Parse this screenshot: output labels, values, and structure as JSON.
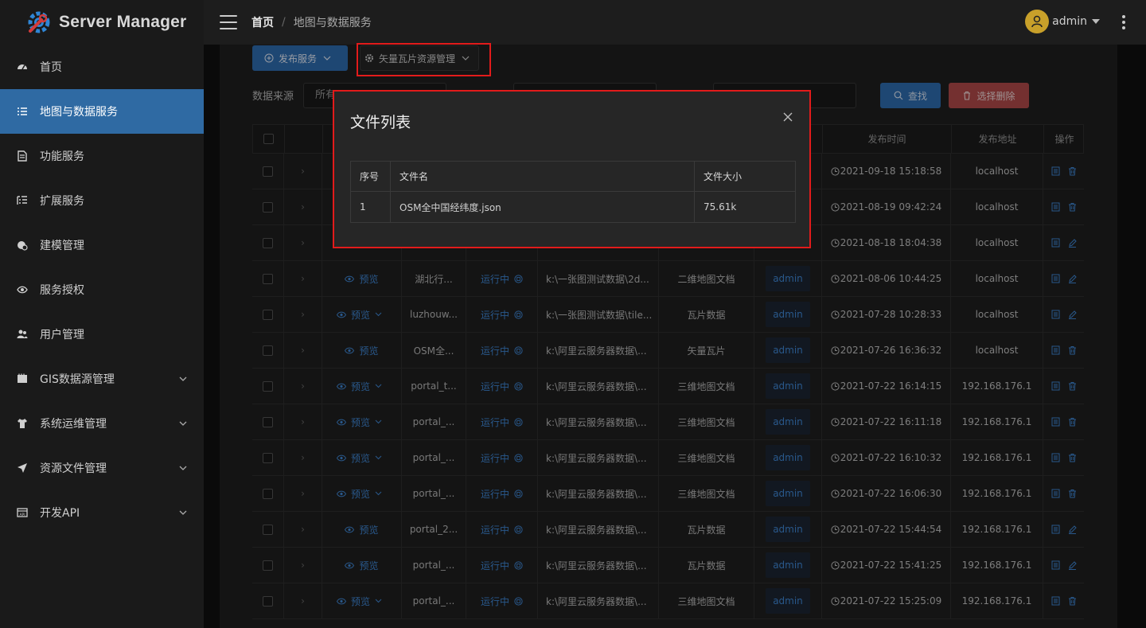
{
  "brand": {
    "name": "Server Manager"
  },
  "sidebar": {
    "items": [
      {
        "label": "首页",
        "icon": "dashboard-icon",
        "expandable": false
      },
      {
        "label": "地图与数据服务",
        "icon": "list-icon",
        "expandable": false,
        "active": true
      },
      {
        "label": "功能服务",
        "icon": "document-icon",
        "expandable": false
      },
      {
        "label": "扩展服务",
        "icon": "outline-icon",
        "expandable": false
      },
      {
        "label": "建模管理",
        "icon": "cube-icon",
        "expandable": false
      },
      {
        "label": "服务授权",
        "icon": "eye-icon",
        "expandable": false
      },
      {
        "label": "用户管理",
        "icon": "users-icon",
        "expandable": false
      },
      {
        "label": "GIS数据源管理",
        "icon": "database-icon",
        "expandable": true
      },
      {
        "label": "系统运维管理",
        "icon": "shirt-icon",
        "expandable": true
      },
      {
        "label": "资源文件管理",
        "icon": "send-icon",
        "expandable": true
      },
      {
        "label": "开发API",
        "icon": "api-icon",
        "expandable": true
      }
    ]
  },
  "header": {
    "breadcrumb_home": "首页",
    "breadcrumb_separator": "/",
    "breadcrumb_current": "地图与数据服务",
    "username": "admin"
  },
  "toolbar": {
    "publish_label": "发布服务",
    "vector_label": "矢量瓦片资源管理",
    "search_label": "查找",
    "bulk_delete_label": "选择删除"
  },
  "filters": {
    "source_label": "数据来源",
    "source_value": "所有"
  },
  "table": {
    "headers": {
      "publish_time": "发布时间",
      "publish_address": "发布地址",
      "actions": "操作"
    },
    "rows": [
      {
        "time": "2021-09-18 15:18:58",
        "address": "localhost",
        "edit": false
      },
      {
        "time": "2021-08-19 09:42:24",
        "address": "localhost",
        "edit": false
      },
      {
        "time": "2021-08-18 18:04:38",
        "address": "localhost",
        "edit": true
      },
      {
        "preview": "预览",
        "name": "湖北行...",
        "status": "运行中",
        "path": "k:\\一张图测试数据\\2d...",
        "type": "二维地图文档",
        "publisher": "admin",
        "time": "2021-08-06 10:44:25",
        "address": "localhost",
        "dropdown": false,
        "edit": true
      },
      {
        "preview": "预览",
        "name": "luzhouw...",
        "status": "运行中",
        "path": "k:\\一张图测试数据\\tile...",
        "type": "瓦片数据",
        "publisher": "admin",
        "time": "2021-07-28 10:28:33",
        "address": "localhost",
        "dropdown": true,
        "edit": true
      },
      {
        "preview": "预览",
        "name": "OSM全...",
        "status": "运行中",
        "path": "k:\\阿里云服务器数据\\...",
        "type": "矢量瓦片",
        "publisher": "admin",
        "time": "2021-07-26 16:36:32",
        "address": "localhost",
        "dropdown": false,
        "edit": false
      },
      {
        "preview": "预览",
        "name": "portal_t...",
        "status": "运行中",
        "path": "k:\\阿里云服务器数据\\...",
        "type": "三维地图文档",
        "publisher": "admin",
        "time": "2021-07-22 16:14:15",
        "address": "192.168.176.1",
        "dropdown": true,
        "edit": false
      },
      {
        "preview": "预览",
        "name": "portal_...",
        "status": "运行中",
        "path": "k:\\阿里云服务器数据\\...",
        "type": "三维地图文档",
        "publisher": "admin",
        "time": "2021-07-22 16:11:18",
        "address": "192.168.176.1",
        "dropdown": true,
        "edit": false
      },
      {
        "preview": "预览",
        "name": "portal_...",
        "status": "运行中",
        "path": "k:\\阿里云服务器数据\\...",
        "type": "三维地图文档",
        "publisher": "admin",
        "time": "2021-07-22 16:10:32",
        "address": "192.168.176.1",
        "dropdown": true,
        "edit": false
      },
      {
        "preview": "预览",
        "name": "portal_...",
        "status": "运行中",
        "path": "k:\\阿里云服务器数据\\...",
        "type": "三维地图文档",
        "publisher": "admin",
        "time": "2021-07-22 16:06:30",
        "address": "192.168.176.1",
        "dropdown": true,
        "edit": false
      },
      {
        "preview": "预览",
        "name": "portal_2...",
        "status": "运行中",
        "path": "k:\\阿里云服务器数据\\...",
        "type": "瓦片数据",
        "publisher": "admin",
        "time": "2021-07-22 15:44:54",
        "address": "192.168.176.1",
        "dropdown": false,
        "edit": true
      },
      {
        "preview": "预览",
        "name": "portal_...",
        "status": "运行中",
        "path": "k:\\阿里云服务器数据\\...",
        "type": "瓦片数据",
        "publisher": "admin",
        "time": "2021-07-22 15:41:25",
        "address": "192.168.176.1",
        "dropdown": false,
        "edit": true
      },
      {
        "preview": "预览",
        "name": "portal_...",
        "status": "运行中",
        "path": "k:\\阿里云服务器数据\\...",
        "type": "三维地图文档",
        "publisher": "admin",
        "time": "2021-07-22 15:25:09",
        "address": "192.168.176.1",
        "dropdown": true,
        "edit": false
      }
    ]
  },
  "modal": {
    "title": "文件列表",
    "headers": {
      "index": "序号",
      "filename": "文件名",
      "size": "文件大小"
    },
    "rows": [
      {
        "index": "1",
        "filename": "OSM全中国经纬度.json",
        "size": "75.61k"
      }
    ]
  },
  "colors": {
    "accent": "#2e6db1",
    "danger": "#b24a4a",
    "link": "#3f87d6",
    "highlight": "#e21b1b",
    "avatar": "#c8a02a"
  }
}
